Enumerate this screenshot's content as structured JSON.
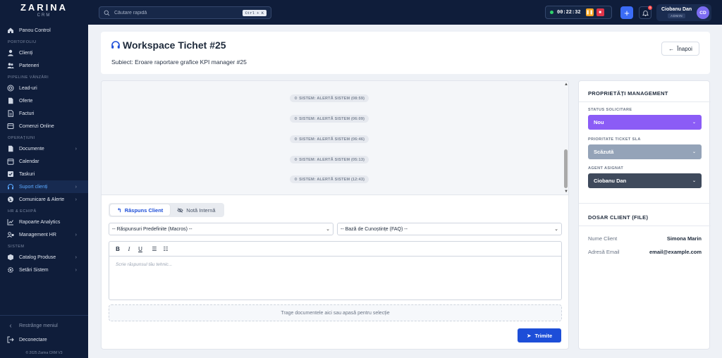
{
  "brand": {
    "name": "ZARINA",
    "sub": "CRM"
  },
  "sidebar": {
    "sections": [
      "PORTOFOLIU",
      "PIPELINE VÂNZĂRI",
      "OPERAȚIUNI",
      "HR & ECHIPĂ",
      "SISTEM"
    ],
    "items": {
      "dashboard": "Panou Control",
      "clients": "Clienți",
      "partners": "Parteneri",
      "leads": "Lead-uri",
      "offers": "Oferte",
      "invoices": "Facturi",
      "orders": "Comenzi Online",
      "documents": "Documente",
      "calendar": "Calendar",
      "tasks": "Taskuri",
      "support": "Suport clienți",
      "comms": "Comunicare & Alerte",
      "analytics": "Rapoarte Analytics",
      "hr": "Management HR",
      "catalog": "Catalog Produse",
      "settings": "Setări Sistem"
    },
    "collapse": "Restrânge meniul",
    "logout": "Deconectare",
    "copyright": "© 2025 Zarina CRM V3"
  },
  "topbar": {
    "search_placeholder": "Căutare rapidă",
    "search_shortcut": "Ctrl + K",
    "timer": "00:22:32",
    "notification_count": "5",
    "user_name": "Ciobanu Dan",
    "user_role": "ADMIN",
    "user_initials": "CD"
  },
  "header": {
    "title": "Workspace Tichet #25",
    "subject": "Subiect: Eroare raportare grafice KPI manager #25",
    "back_label": "Înapoi"
  },
  "messages": [
    "SISTEM: ALERTĂ SISTEM (08:59)",
    "SISTEM: ALERTĂ SISTEM (06:09)",
    "SISTEM: ALERTĂ SISTEM (06:46)",
    "SISTEM: ALERTĂ SISTEM (05:13)",
    "SISTEM: ALERTĂ SISTEM (12:43)"
  ],
  "reply": {
    "tab_client": "Răspuns Client",
    "tab_internal": "Notă Internă",
    "macros": "-- Răspunsuri Predefinite (Macros) --",
    "faq": "-- Bază de Cunoștințe (FAQ) --",
    "editor_placeholder": "Scrie răspunsul tău tehnic...",
    "dropzone": "Trage documentele aici sau apasă pentru selecție",
    "send": "Trimite"
  },
  "management": {
    "title": "PROPRIETĂȚI MANAGEMENT",
    "status_label": "STATUS SOLICITARE",
    "status_value": "Nou",
    "priority_label": "PRIORITATE TICKET SLA",
    "priority_value": "Scăzută",
    "agent_label": "AGENT ASIGNAT",
    "agent_value": "Ciobanu Dan",
    "colors": {
      "status": "#8b5cf6",
      "priority": "#94a3b8",
      "agent": "#3f4a5c"
    }
  },
  "client_file": {
    "title": "DOSAR CLIENT (FILE)",
    "name_label": "Nume Client",
    "name_value": "Simona Marin",
    "email_label": "Adresă Email",
    "email_value": "email@example.com"
  },
  "icons": [
    "home-icon",
    "user-icon",
    "users-icon",
    "target-icon",
    "document-icon",
    "cart-icon",
    "calendar-icon",
    "checkbox-icon",
    "headset-icon",
    "globe-icon",
    "chart-icon",
    "people-icon",
    "box-icon",
    "gear-icon",
    "search-icon",
    "bell-icon",
    "plus-icon",
    "pause-icon",
    "stop-icon",
    "arrow-left-icon",
    "reply-icon",
    "eye-off-icon",
    "send-icon",
    "logout-icon"
  ]
}
